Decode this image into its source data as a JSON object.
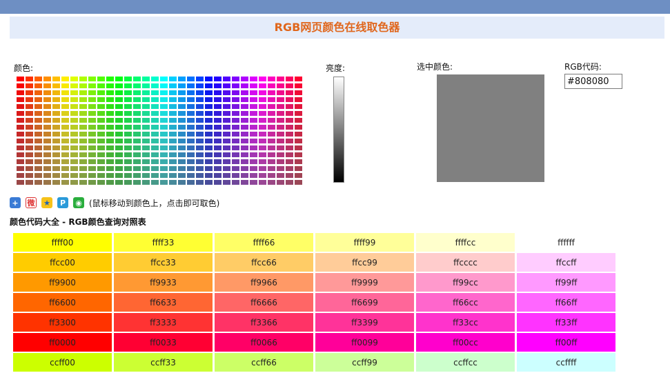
{
  "header": {
    "title": "RGB网页颜色在线取色器"
  },
  "labels": {
    "color": "颜色:",
    "brightness": "亮度:",
    "selected": "选中颜色:",
    "rgb_code": "RGB代码:"
  },
  "rgb_input": {
    "value": "#808080"
  },
  "selected_color": "#808080",
  "share": {
    "hint": "(鼠标移动到颜色上，点击即可取色)",
    "icons": [
      "plus-icon",
      "weibo-icon",
      "qzone-icon",
      "tencent-weibo-icon",
      "wechat-icon"
    ]
  },
  "section_title": "颜色代码大全 - RGB颜色查询对照表",
  "color_table": [
    [
      "ffff00",
      "ffff33",
      "ffff66",
      "ffff99",
      "ffffcc",
      "ffffff"
    ],
    [
      "ffcc00",
      "ffcc33",
      "ffcc66",
      "ffcc99",
      "ffcccc",
      "ffccff"
    ],
    [
      "ff9900",
      "ff9933",
      "ff9966",
      "ff9999",
      "ff99cc",
      "ff99ff"
    ],
    [
      "ff6600",
      "ff6633",
      "ff6666",
      "ff6699",
      "ff66cc",
      "ff66ff"
    ],
    [
      "ff3300",
      "ff3333",
      "ff3366",
      "ff3399",
      "ff33cc",
      "ff33ff"
    ],
    [
      "ff0000",
      "ff0033",
      "ff0066",
      "ff0099",
      "ff00cc",
      "ff00ff"
    ],
    [
      "ccff00",
      "ccff33",
      "ccff66",
      "ccff99",
      "ccffcc",
      "ccffff"
    ]
  ]
}
